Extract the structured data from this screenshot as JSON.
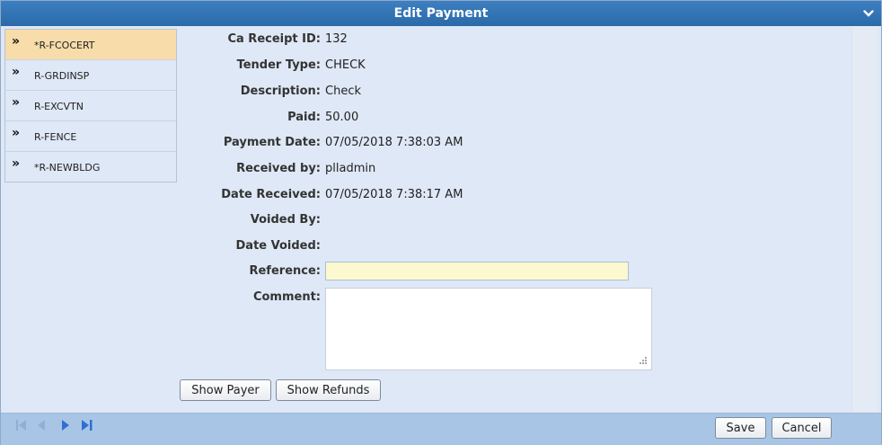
{
  "window": {
    "title": "Edit Payment"
  },
  "sidebar": {
    "items": [
      {
        "label": "*R-FCOCERT",
        "selected": true
      },
      {
        "label": "R-GRDINSP"
      },
      {
        "label": "R-EXCVTN"
      },
      {
        "label": "R-FENCE"
      },
      {
        "label": "*R-NEWBLDG"
      }
    ]
  },
  "fields": {
    "receipt_id": {
      "label": "Ca Receipt ID:",
      "value": "132"
    },
    "tender_type": {
      "label": "Tender Type:",
      "value": "CHECK"
    },
    "description": {
      "label": "Description:",
      "value": "Check"
    },
    "paid": {
      "label": "Paid:",
      "value": "50.00"
    },
    "payment_date": {
      "label": "Payment Date:",
      "value": "07/05/2018 7:38:03 AM"
    },
    "received_by": {
      "label": "Received by:",
      "value": "plladmin"
    },
    "date_received": {
      "label": "Date Received:",
      "value": "07/05/2018 7:38:17 AM"
    },
    "voided_by": {
      "label": "Voided By:",
      "value": ""
    },
    "date_voided": {
      "label": "Date Voided:",
      "value": ""
    },
    "reference": {
      "label": "Reference:",
      "value": ""
    },
    "comment": {
      "label": "Comment:",
      "value": ""
    }
  },
  "buttons": {
    "show_payer": "Show Payer",
    "show_refunds": "Show Refunds",
    "save": "Save",
    "cancel": "Cancel"
  },
  "icons": {
    "collapse": "chevron-down-icon",
    "nav_first": "first-page-icon",
    "nav_prev": "prev-page-icon",
    "nav_next": "next-page-icon",
    "nav_last": "last-page-icon"
  },
  "colors": {
    "titlebar": "#2a6aa9",
    "background": "#dfe8f6",
    "selected_item": "#f8dcaa",
    "reference_input": "#fcf9cf",
    "footer": "#a9c5e6"
  }
}
